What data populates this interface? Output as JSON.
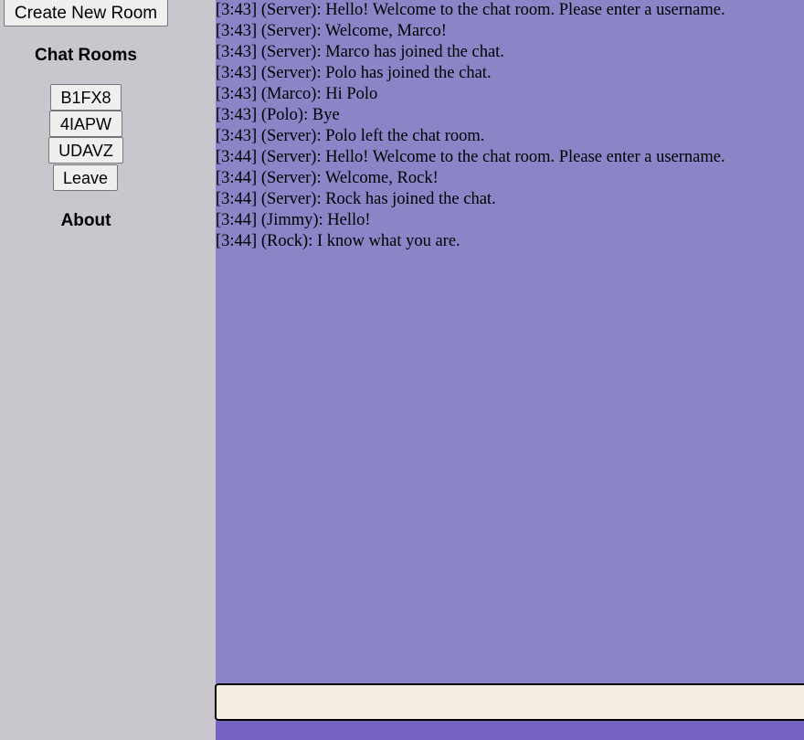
{
  "sidebar": {
    "create_room_label": "Create New Room",
    "rooms_heading": "Chat Rooms",
    "rooms": [
      {
        "label": "B1FX8"
      },
      {
        "label": "4IAPW"
      },
      {
        "label": "UDAVZ"
      }
    ],
    "leave_label": "Leave",
    "about_label": "About"
  },
  "chat": {
    "messages": [
      {
        "text": "[3:43] (Server): Hello! Welcome to the chat room. Please enter a username."
      },
      {
        "text": "[3:43] (Server): Welcome, Marco!"
      },
      {
        "text": "[3:43] (Server): Marco has joined the chat."
      },
      {
        "text": "[3:43] (Server): Polo has joined the chat."
      },
      {
        "text": "[3:43] (Marco): Hi Polo"
      },
      {
        "text": "[3:43] (Polo): Bye"
      },
      {
        "text": "[3:43] (Server): Polo left the chat room."
      },
      {
        "text": "[3:44] (Server): Hello! Welcome to the chat room. Please enter a username."
      },
      {
        "text": "[3:44] (Server): Welcome, Rock!"
      },
      {
        "text": "[3:44] (Server): Rock has joined the chat."
      },
      {
        "text": "[3:44] (Jimmy): Hello!"
      },
      {
        "text": "[3:44] (Rock): I know what you are."
      }
    ],
    "input_value": ""
  },
  "colors": {
    "sidebar_bg": "#c9c6ce",
    "chat_bg": "#8b85c8",
    "input_bg": "#f5ece3",
    "bottom_bar": "#7561c0"
  }
}
